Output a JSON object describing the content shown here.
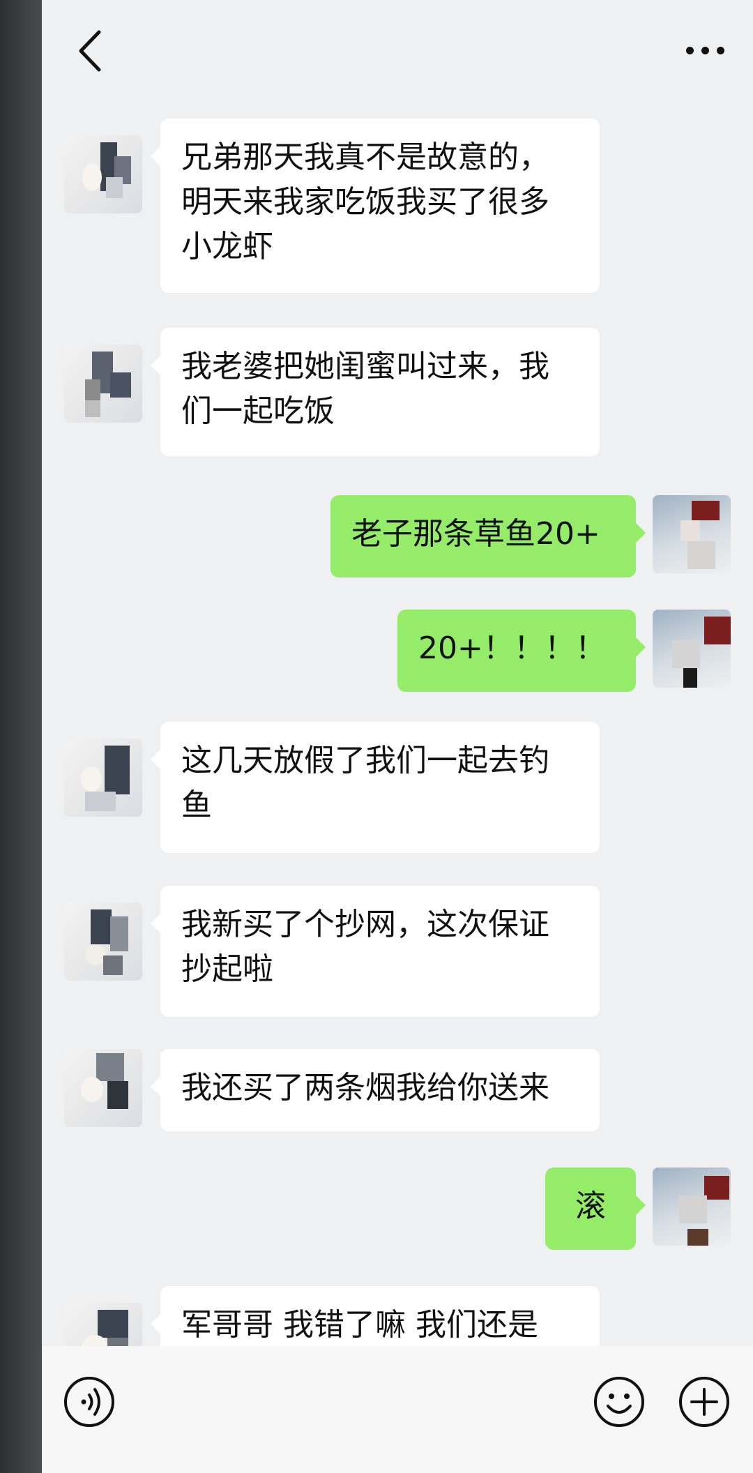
{
  "header": {
    "title": "",
    "back_icon": "chevron-left-icon",
    "more_icon": "more-dots-icon"
  },
  "messages": [
    {
      "side": "left",
      "text": "兄弟那天我真不是故意的，明天来我家吃饭我买了很多小龙虾"
    },
    {
      "side": "left",
      "text": "我老婆把她闺蜜叫过来，我们一起吃饭"
    },
    {
      "side": "right",
      "text": "老子那条草鱼20+"
    },
    {
      "side": "right",
      "text": "20+！！！！"
    },
    {
      "side": "left",
      "text": "这几天放假了我们一起去钓鱼"
    },
    {
      "side": "left",
      "text": "我新买了个抄网，这次保证抄起啦"
    },
    {
      "side": "left",
      "text": "我还买了两条烟我给你送来"
    },
    {
      "side": "right",
      "text": "滚"
    },
    {
      "side": "left",
      "text": "军哥哥 我错了嘛 我们还是"
    }
  ],
  "bottom_bar": {
    "voice_icon": "voice-icon",
    "emoji_icon": "emoji-icon",
    "plus_icon": "plus-circle-icon",
    "input_value": ""
  },
  "colors": {
    "screen_bg": "#eef0f1",
    "bubble_self": "#95ec69",
    "bubble_other": "#ffffff"
  }
}
